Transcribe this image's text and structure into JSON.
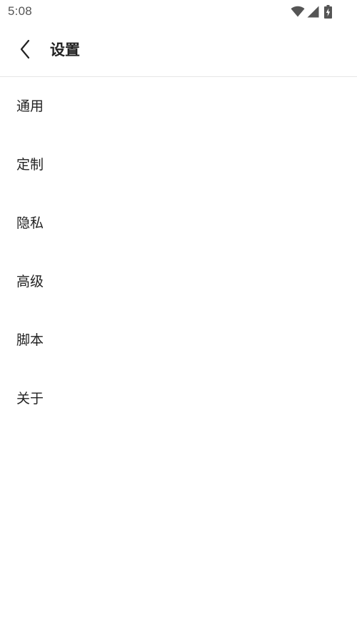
{
  "status_bar": {
    "time": "5:08",
    "icons": [
      "wifi-icon",
      "signal-icon",
      "battery-charging-icon"
    ]
  },
  "header": {
    "back_icon": "chevron-left-icon",
    "title": "设置"
  },
  "menu": {
    "items": [
      {
        "label": "通用"
      },
      {
        "label": "定制"
      },
      {
        "label": "隐私"
      },
      {
        "label": "高级"
      },
      {
        "label": "脚本"
      },
      {
        "label": "关于"
      }
    ]
  },
  "colors": {
    "background": "#ffffff",
    "text": "#222222",
    "status_text": "#555555",
    "divider": "#e6e6e6"
  }
}
